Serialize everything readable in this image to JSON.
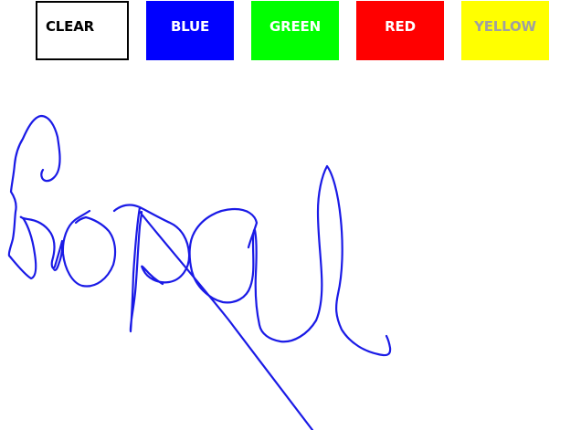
{
  "toolbar": {
    "buttons": [
      {
        "id": "clear",
        "label": "CLEAR",
        "bg": "#ffffff",
        "fg": "#000000"
      },
      {
        "id": "blue",
        "label": "BLUE",
        "bg": "#0000ff",
        "fg": "#ffffff"
      },
      {
        "id": "green",
        "label": "GREEN",
        "bg": "#00ff00",
        "fg": "#ffffff"
      },
      {
        "id": "red",
        "label": "RED",
        "bg": "#ff0000",
        "fg": "#ffffff"
      },
      {
        "id": "yellow",
        "label": "YELLOW",
        "bg": "#ffff00",
        "fg": "#a0a0a0"
      }
    ]
  },
  "canvas": {
    "stroke_color": "#1a1ae6"
  }
}
